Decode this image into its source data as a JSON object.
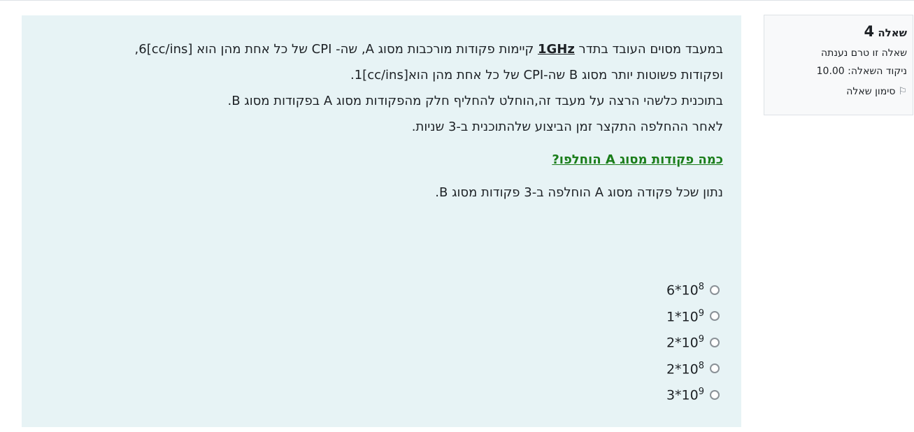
{
  "info": {
    "question_word": "שאלה",
    "question_number": "4",
    "status": "שאלה זו טרם נענתה",
    "grade": "ניקוד השאלה: 10.00",
    "flag_label": "סימון שאלה",
    "flag_icon": "flag-icon"
  },
  "question": {
    "line1_a": "במעבד מסוים העובד בתדר ",
    "line1_freq": "1GHz",
    "line1_b": " קיימות פקודות מורכבות מסוג A, שה-     CPI של כל אחת מהן הוא [cc/ins]6,",
    "line2": "ופקודות פשוטות יותר מסוג  B שה-CPI של כל אחת מהן הוא[cc/ins]1.",
    "line3": "בתוכנית כלשהי הרצה על מעבד זה,הוחלט להחליף חלק מהפקודות מסוג  A בפקודות מסוג B.",
    "line4": "לאחר ההחלפה התקצר זמן הביצוע שלהתוכנית ב-3 שניות.",
    "ask": "כמה פקודות מסוג  A הוחלפו?",
    "given": "נתון שכל פקודה מסוג  A הוחלפה ב-3 פקודות מסוג B."
  },
  "answers": [
    {
      "base": "6*10",
      "exp": "8"
    },
    {
      "base": "1*10",
      "exp": "9"
    },
    {
      "base": "2*10",
      "exp": "9"
    },
    {
      "base": "2*10",
      "exp": "8"
    },
    {
      "base": "3*10",
      "exp": "9"
    }
  ]
}
